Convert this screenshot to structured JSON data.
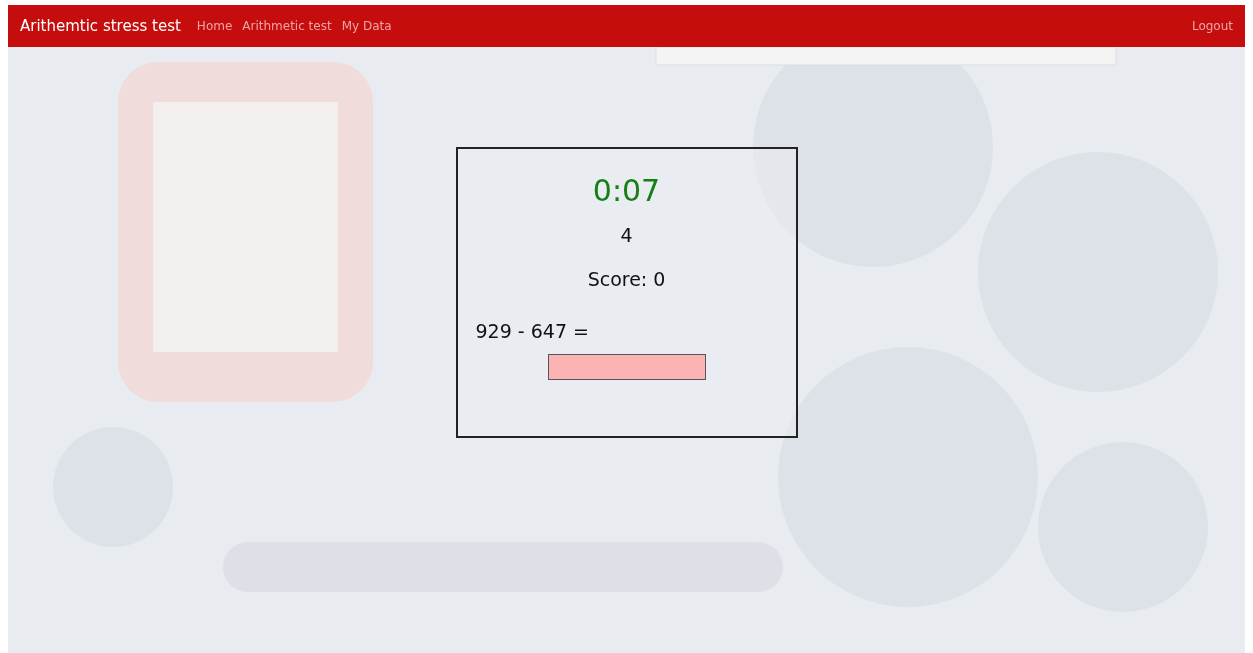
{
  "navbar": {
    "brand": "Arithemtic stress test",
    "links": [
      {
        "label": "Home"
      },
      {
        "label": "Arithmetic test"
      },
      {
        "label": "My Data"
      }
    ],
    "logout": "Logout"
  },
  "test": {
    "timer": "0:07",
    "countdown": "4",
    "score": "Score: 0",
    "problem": "929 - 647 =",
    "answer": {
      "wrong": true
    }
  }
}
